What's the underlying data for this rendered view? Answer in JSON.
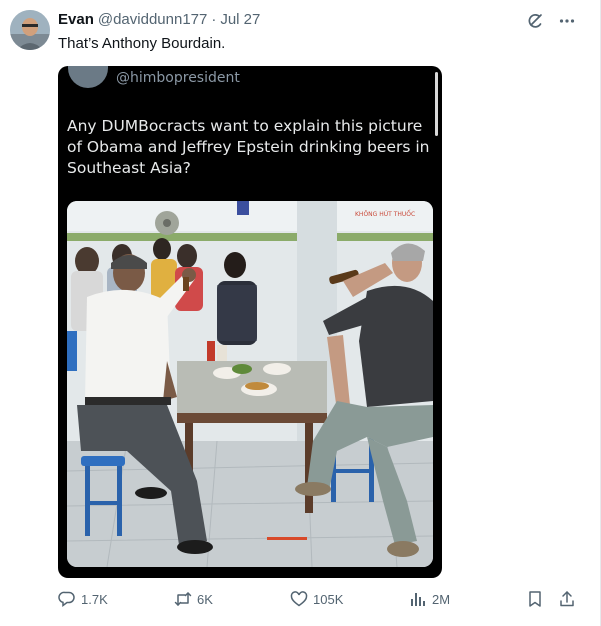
{
  "tweet": {
    "author_name": "Evan",
    "author_handle": "@daviddunn177",
    "separator": "·",
    "date": "Jul 27",
    "text": "That’s Anthony Bourdain."
  },
  "quoted_image": {
    "handle": "@himbopresident",
    "text": "Any DUMBocracts want to explain this picture of Obama and Jeffrey Epstein drinking beers in Southeast Asia?",
    "sign_text": "KHÔNG HÚT THUỐC"
  },
  "top_icons": [
    "grok-icon",
    "more-icon"
  ],
  "actions": {
    "replies": "1.7K",
    "reposts": "6K",
    "likes": "105K",
    "views": "2M"
  },
  "colors": {
    "text_primary": "#0f1419",
    "text_secondary": "#536471",
    "card_background": "#000000",
    "card_text": "#e7e9ea"
  }
}
